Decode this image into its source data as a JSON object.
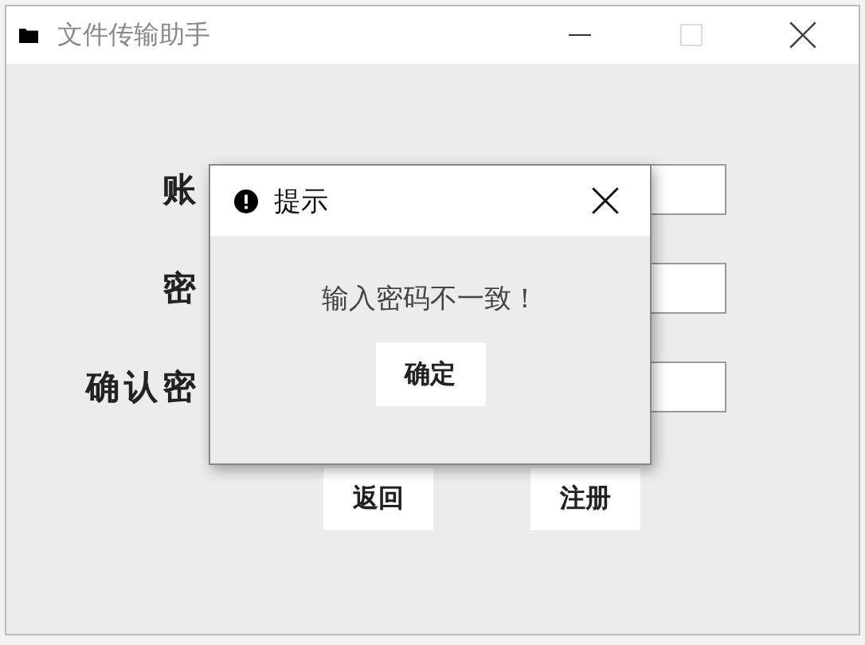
{
  "window": {
    "title": "文件传输助手"
  },
  "form": {
    "fields": [
      {
        "label": "账"
      },
      {
        "label": "密"
      },
      {
        "label": "确认密"
      }
    ],
    "buttons": [
      "返回",
      "注册"
    ]
  },
  "dialog": {
    "title": "提示",
    "message": "输入密码不一致！",
    "button": "确定"
  }
}
